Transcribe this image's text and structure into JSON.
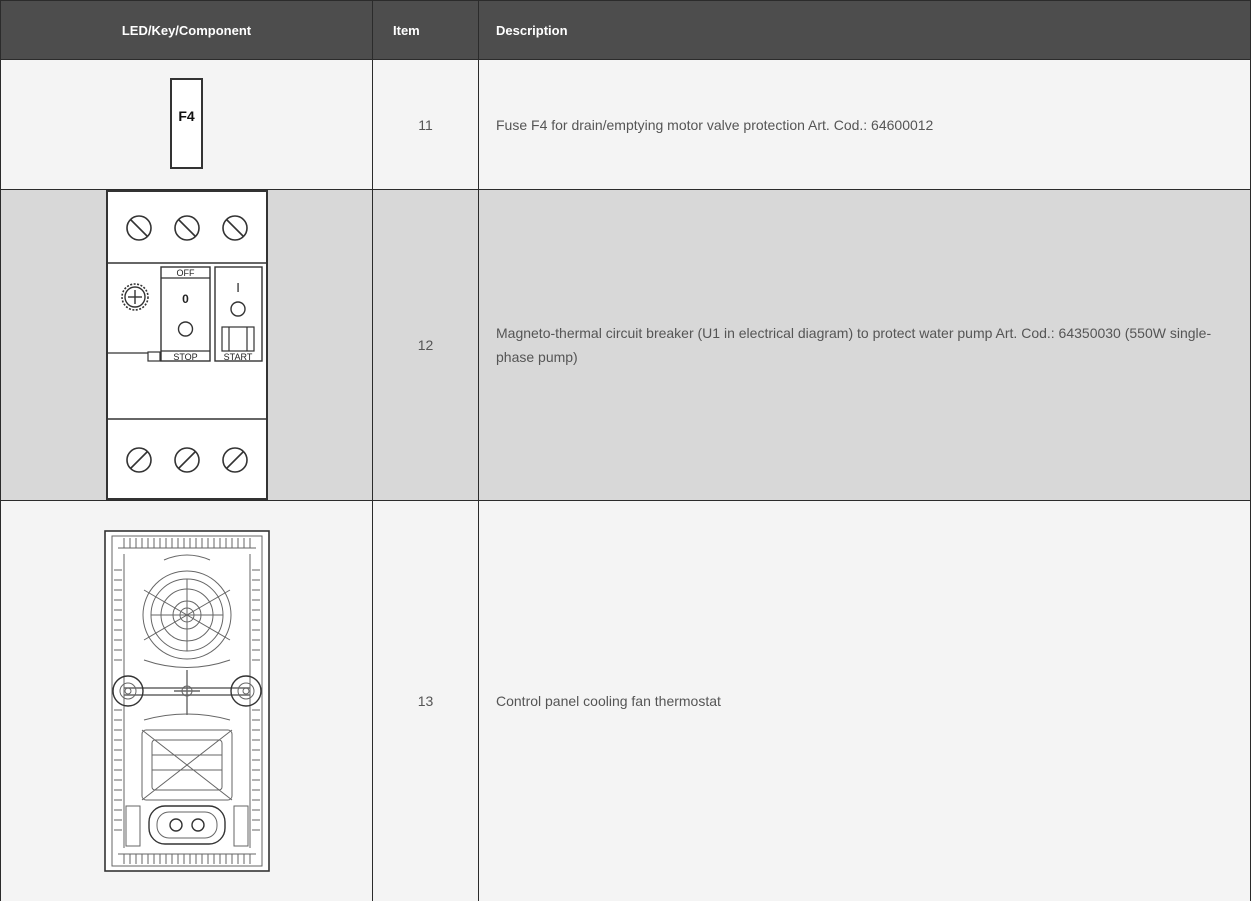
{
  "table": {
    "headers": {
      "component": "LED/Key/Component",
      "item": "Item",
      "description": "Description"
    },
    "rows": [
      {
        "component_label": "F4",
        "component_icon": "fuse-icon",
        "item": "11",
        "description": "Fuse F4 for drain/emptying motor valve protection Art. Cod.: 64600012"
      },
      {
        "component_icon": "circuit-breaker-icon",
        "breaker_labels": {
          "off": "OFF",
          "zero": "0",
          "one": "I",
          "stop": "STOP",
          "start": "START"
        },
        "item": "12",
        "description": "Magneto-thermal circuit breaker (U1 in electrical diagram) to protect water pump Art. Cod.: 64350030 (550W single-phase pump)"
      },
      {
        "component_icon": "thermostat-icon",
        "item": "13",
        "description": "Control panel cooling fan thermostat"
      }
    ]
  }
}
